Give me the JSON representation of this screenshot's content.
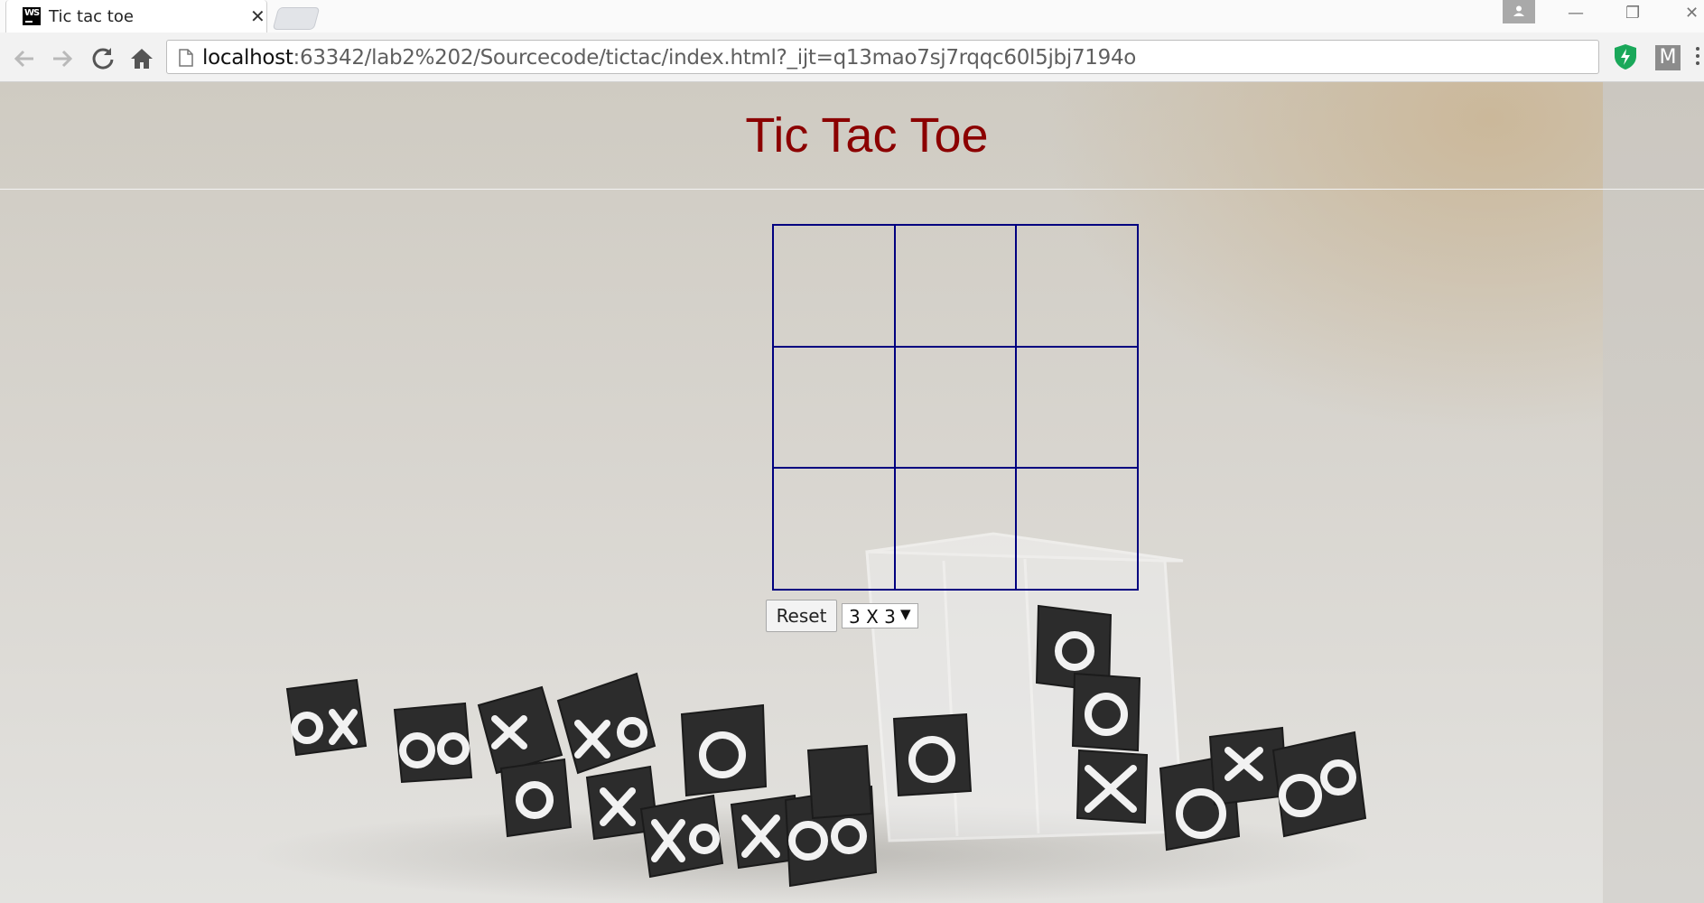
{
  "browser": {
    "tab_title": "Tic tac toe",
    "favicon_text": "WS",
    "close_glyph": "✕",
    "url_host": "localhost",
    "url_rest": ":63342/lab2%202/Sourcecode/tictac/index.html?_ijt=q13mao7sj7rqqc60l5jbj7194o",
    "extension_m": "M",
    "window_controls": [
      "—",
      "❐",
      "✕"
    ],
    "icons": [
      "back-icon",
      "forward-icon",
      "reload-icon",
      "home-icon",
      "page-icon",
      "shield-extension-icon",
      "menu-icon",
      "profile-icon"
    ]
  },
  "game": {
    "title": "Tic Tac Toe",
    "board": [
      "",
      "",
      "",
      "",
      "",
      "",
      "",
      "",
      ""
    ],
    "reset_label": "Reset",
    "size_selected": "3 X 3",
    "grid_color": "#000080",
    "title_color": "#8b0000"
  }
}
